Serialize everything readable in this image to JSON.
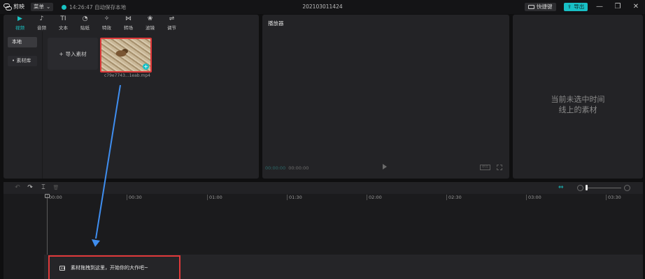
{
  "titlebar": {
    "app_name": "剪映",
    "menu_label": "菜单",
    "autosave_text": "14:26:47 自动保存本地",
    "project_name": "202103011424",
    "shortcut_label": "快捷键",
    "export_label": "导出",
    "win_min": "—",
    "win_max": "❐",
    "win_close": "✕"
  },
  "media_tabs": [
    {
      "label": "视频",
      "icon": "▶",
      "active": true
    },
    {
      "label": "音频",
      "icon": "♪"
    },
    {
      "label": "文本",
      "icon": "TI"
    },
    {
      "label": "贴纸",
      "icon": "◔"
    },
    {
      "label": "特效",
      "icon": "✧"
    },
    {
      "label": "转场",
      "icon": "⋈"
    },
    {
      "label": "滤镜",
      "icon": "❀"
    },
    {
      "label": "调节",
      "icon": "⇌"
    }
  ],
  "media_sidebar": {
    "local": "本地",
    "library": "• 素材库"
  },
  "media": {
    "import_label": "导入素材",
    "import_icon": "+",
    "clip_name": "c79e7743...1eab.mp4",
    "clip_add_icon": "+"
  },
  "player": {
    "header": "播放器",
    "current_time": "00:00:00",
    "total_time": "00:00:00",
    "ratio_label": "原比"
  },
  "properties": {
    "empty_line1": "当前未选中时间",
    "empty_line2": "线上的素材"
  },
  "timeline": {
    "tools": {
      "undo": "↶",
      "redo": "↷",
      "split": "⌶",
      "delete": "🗑"
    },
    "link_icon": "⇔",
    "ruler_ticks": [
      "00:00",
      "00:30",
      "01:00",
      "01:30",
      "02:00",
      "02:30",
      "03:00",
      "03:30"
    ],
    "drop_hint": "素材拖拽到这里，开始你的大作吧~"
  },
  "colors": {
    "accent": "#18c0c6",
    "highlight_red": "#e0393a",
    "arrow_blue": "#3f8ef0"
  }
}
